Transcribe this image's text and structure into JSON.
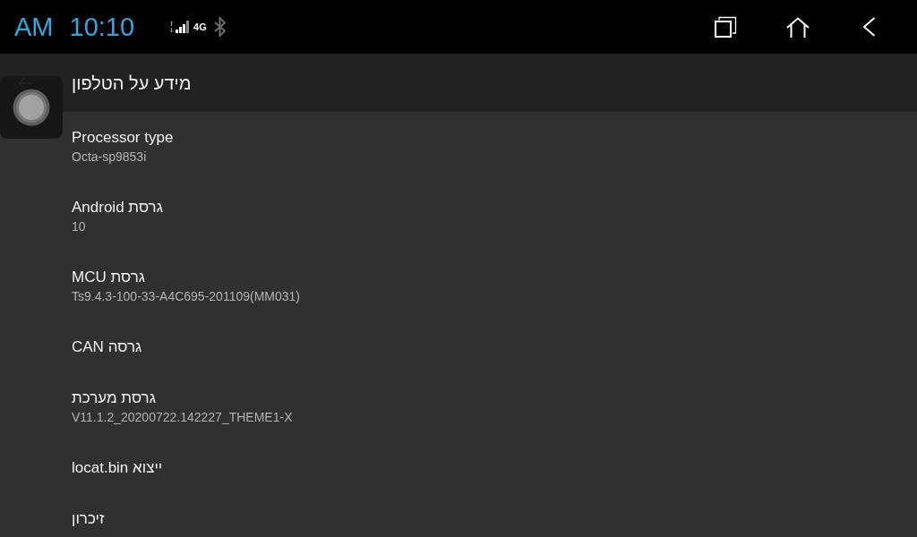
{
  "status_bar": {
    "am_pm": "AM",
    "time": "10:10",
    "network_type": "4G",
    "bluetooth_connected": false
  },
  "toolbar": {
    "title": "מידע על הטלפון"
  },
  "preferences": [
    {
      "title": "Processor type",
      "summary": "Octa-sp9853i"
    },
    {
      "title": "גרסת Android",
      "summary": "10"
    },
    {
      "title": "גרסת MCU",
      "summary": "Ts9.4.3-100-33-A4C695-201109(MM031)"
    },
    {
      "title": "גרסה CAN"
    },
    {
      "title": "גרסת מערכת",
      "summary": "V11.1.2_20200722.142227_THEME1-X"
    },
    {
      "title": "ייצוא locat.bin"
    },
    {
      "title": "זיכרון"
    }
  ]
}
